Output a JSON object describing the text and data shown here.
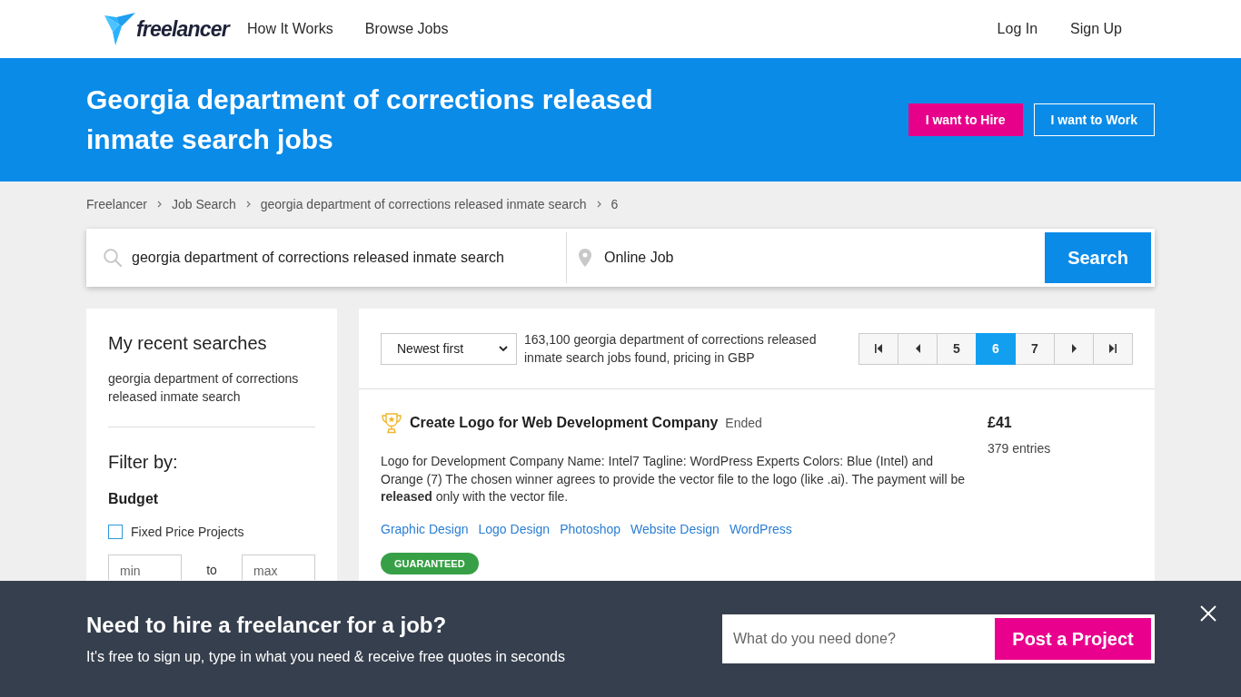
{
  "header": {
    "logo_text": "freelancer",
    "nav": [
      "How It Works",
      "Browse Jobs"
    ],
    "account_links": [
      "Log In",
      "Sign Up"
    ]
  },
  "hero": {
    "title": "Georgia department of corrections released inmate search jobs",
    "buttons": [
      {
        "label": "I want to Hire",
        "kind": "filled"
      },
      {
        "label": "I want to Work",
        "kind": "outline"
      }
    ]
  },
  "breadcrumb": [
    "Freelancer",
    "Job Search",
    "georgia department of corrections released inmate search",
    "6"
  ],
  "search": {
    "query": "georgia department of corrections released inmate search",
    "location": "Online Job",
    "button": "Search"
  },
  "sidebar": {
    "recent_title": "My recent searches",
    "recent_searches": [
      "georgia department of corrections released inmate search"
    ],
    "filter_title": "Filter by:",
    "budget": {
      "title": "Budget",
      "fixed_price": {
        "label": "Fixed Price Projects",
        "checked": false
      },
      "min": {
        "placeholder": "min"
      },
      "separator": "to",
      "max": {
        "placeholder": "max"
      }
    }
  },
  "results": {
    "sort": "Newest first",
    "summary": "163,100 georgia department of corrections released inmate search jobs found, pricing in GBP",
    "pagination": [
      {
        "kind": "first",
        "selected": false
      },
      {
        "kind": "prev",
        "selected": false
      },
      {
        "kind": "page",
        "label": "5",
        "selected": false
      },
      {
        "kind": "page",
        "label": "6",
        "selected": true
      },
      {
        "kind": "page",
        "label": "7",
        "selected": false
      },
      {
        "kind": "next",
        "selected": false
      },
      {
        "kind": "last",
        "selected": false
      }
    ],
    "jobs": [
      {
        "title": "Create Logo for Web Development Company",
        "status": "Ended",
        "price": "£41",
        "entries": "379 entries",
        "description": "Logo for Development Company Name: Intel7 Tagline: WordPress Experts Colors: Blue (Intel) and Orange (7) The chosen winner agrees to provide the vector file to the logo (like .ai). The payment will be **released** only with the vector file.",
        "tags": [
          "Graphic Design",
          "Logo Design",
          "Photoshop",
          "Website Design",
          "WordPress"
        ],
        "badges": [
          "GUARANTEED"
        ]
      }
    ]
  },
  "banner": {
    "heading": "Need to hire a freelancer for a job?",
    "subtext": "It's free to sign up, type in what you need & receive free quotes in seconds",
    "input": {
      "placeholder": "What do you need done?"
    },
    "button": "Post a Project"
  }
}
